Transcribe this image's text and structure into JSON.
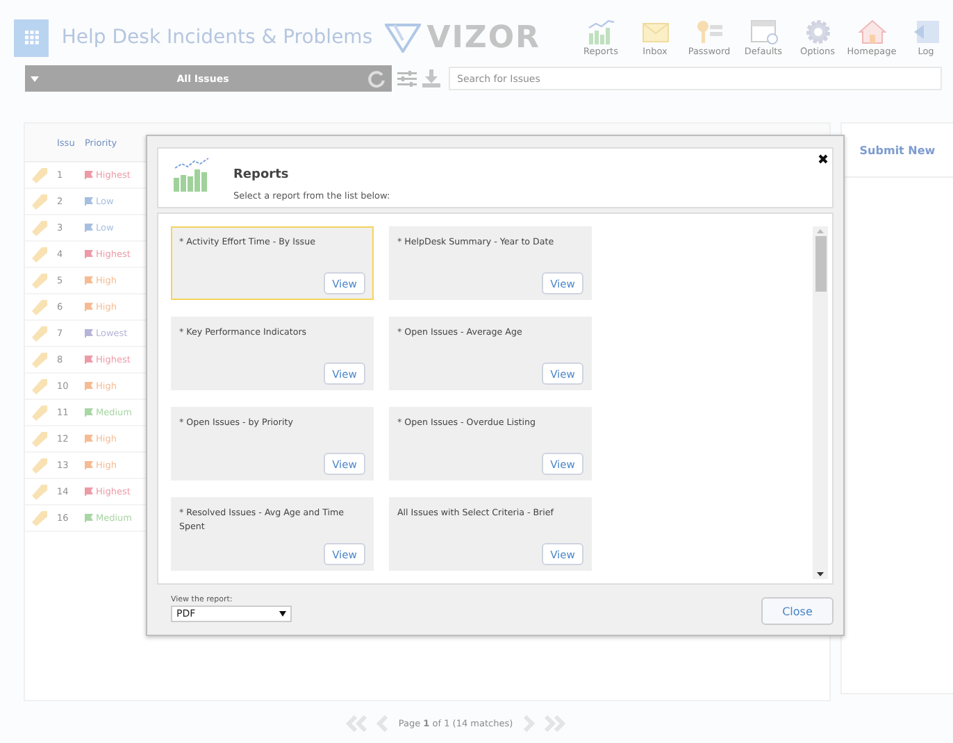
{
  "header": {
    "title": "Help Desk Incidents & Problems",
    "logo": "VIZOR",
    "tools": [
      {
        "label": "Reports"
      },
      {
        "label": "Inbox"
      },
      {
        "label": "Password"
      },
      {
        "label": "Defaults"
      },
      {
        "label": "Options"
      },
      {
        "label": "Homepage"
      },
      {
        "label": "Log"
      }
    ]
  },
  "toolbar": {
    "view": "All Issues",
    "search_placeholder": "Search for Issues"
  },
  "table": {
    "columns": [
      "Issu",
      "Priority"
    ],
    "rows": [
      {
        "number": "1",
        "priority": "Highest",
        "color": "#ee9aa6"
      },
      {
        "number": "2",
        "priority": "Low",
        "color": "#a6bee0"
      },
      {
        "number": "3",
        "priority": "Low",
        "color": "#a6bee0"
      },
      {
        "number": "4",
        "priority": "Highest",
        "color": "#ee9aa6"
      },
      {
        "number": "5",
        "priority": "High",
        "color": "#f6bb92"
      },
      {
        "number": "6",
        "priority": "High",
        "color": "#f6bb92"
      },
      {
        "number": "7",
        "priority": "Lowest",
        "color": "#b6b4d8"
      },
      {
        "number": "8",
        "priority": "Highest",
        "color": "#ee9aa6"
      },
      {
        "number": "10",
        "priority": "High",
        "color": "#f6bb92"
      },
      {
        "number": "11",
        "priority": "Medium",
        "color": "#a8d6a4"
      },
      {
        "number": "12",
        "priority": "High",
        "color": "#f6bb92"
      },
      {
        "number": "13",
        "priority": "High",
        "color": "#f6bb92"
      },
      {
        "number": "14",
        "priority": "Highest",
        "color": "#ee9aa6"
      },
      {
        "number": "16",
        "priority": "Medium",
        "color": "#a8d6a4"
      }
    ]
  },
  "side": {
    "button": "Submit New"
  },
  "pagination": {
    "text": "Page **1** of 1 (14 matches)"
  },
  "dialog": {
    "title": "Reports",
    "subtitle": "Select a report from the list below:",
    "reports": [
      {
        "title": "* Activity Effort Time - By Issue",
        "button": "View",
        "selected": true
      },
      {
        "title": "* HelpDesk Summary - Year to Date",
        "button": "View",
        "selected": false
      },
      {
        "title": "* Key Performance Indicators",
        "button": "View",
        "selected": false
      },
      {
        "title": "* Open Issues - Average Age",
        "button": "View",
        "selected": false
      },
      {
        "title": "* Open Issues - by Priority",
        "button": "View",
        "selected": false
      },
      {
        "title": "* Open Issues - Overdue Listing",
        "button": "View",
        "selected": false
      },
      {
        "title": "* Resolved Issues - Avg Age and Time Spent",
        "button": "View",
        "selected": false
      },
      {
        "title": "All Issues with Select Criteria - Brief",
        "button": "View",
        "selected": false
      }
    ],
    "format_label": "View the report:",
    "format": "PDF",
    "close": "Close"
  }
}
